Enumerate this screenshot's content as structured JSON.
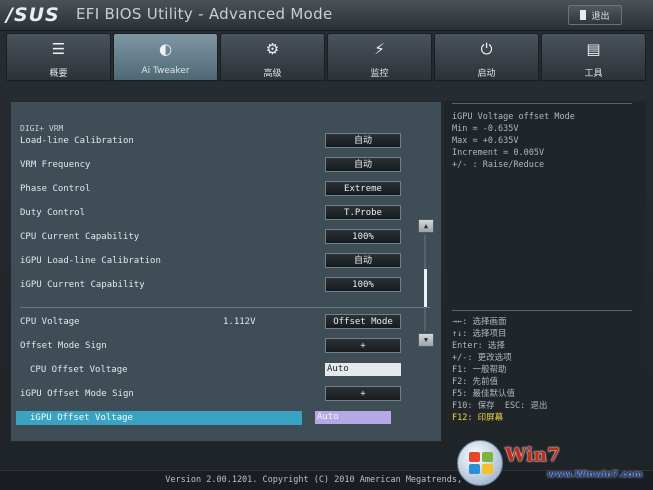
{
  "header": {
    "brand": "/SUS",
    "title": "EFI BIOS Utility - Advanced Mode",
    "exit_label": "退出"
  },
  "tabs": [
    {
      "label": "概要",
      "icon": "list-icon",
      "glyph": "☰"
    },
    {
      "label": "Ai Tweaker",
      "icon": "tweaker-icon",
      "glyph": "◐"
    },
    {
      "label": "高级",
      "icon": "advanced-icon",
      "glyph": "⚙"
    },
    {
      "label": "监控",
      "icon": "monitor-icon",
      "glyph": "⚡"
    },
    {
      "label": "启动",
      "icon": "power-icon",
      "glyph": "⏻"
    },
    {
      "label": "工具",
      "icon": "tool-icon",
      "glyph": "▤"
    }
  ],
  "active_tab": "Ai Tweaker",
  "section": "DIGI+ VRM",
  "settings": [
    {
      "label": "Load-line Calibration",
      "value": "自动"
    },
    {
      "label": "VRM Frequency",
      "value": "自动"
    },
    {
      "label": "Phase Control",
      "value": "Extreme"
    },
    {
      "label": "Duty Control",
      "value": "T.Probe"
    },
    {
      "label": "CPU Current Capability",
      "value": "100%"
    },
    {
      "label": "iGPU Load-line Calibration",
      "value": "自动"
    },
    {
      "label": "iGPU Current Capability",
      "value": "100%"
    }
  ],
  "voltage": {
    "cpu_voltage_label": "CPU Voltage",
    "cpu_voltage_reading": "1.112V",
    "cpu_voltage_mode": "Offset Mode",
    "offset_sign_label": "Offset Mode Sign",
    "offset_sign_value": "+",
    "cpu_offset_label": "CPU Offset Voltage",
    "cpu_offset_value": "Auto",
    "igpu_sign_label": "iGPU Offset Mode Sign",
    "igpu_sign_value": "+",
    "igpu_offset_label": "iGPU Offset Voltage",
    "igpu_offset_value": "Auto"
  },
  "scroll": {
    "up": "▲",
    "down": "▼"
  },
  "help": {
    "line1": "iGPU Voltage offset Mode",
    "line2": "Min = -0.635V",
    "line3": "Max = +0.635V",
    "line4": "Increment = 0.005V",
    "line5": "+/- : Raise/Reduce"
  },
  "keys": {
    "k1": "→←: 选择画面",
    "k2": "↑↓: 选择项目",
    "k3": "Enter: 选择",
    "k4": "+/-: 更改选项",
    "k5": "F1: 一般帮助",
    "k6": "F2: 先前值",
    "k7": "F5: 最佳默认值",
    "k8": "F10: 保存  ESC: 退出",
    "k9": "F12: 印屏幕"
  },
  "footer": {
    "version": "Version 2.00.1201. Copyright (C) 2010 American Megatrends, Inc."
  },
  "watermark": {
    "brand": "Win7",
    "url": "www.Winwin7.com"
  },
  "colors": {
    "selection": "#3aa3c2",
    "highlight_field": "#b4a8e6",
    "help_hotkey": "#f2da3e",
    "active_tab": "#7f97a5"
  }
}
